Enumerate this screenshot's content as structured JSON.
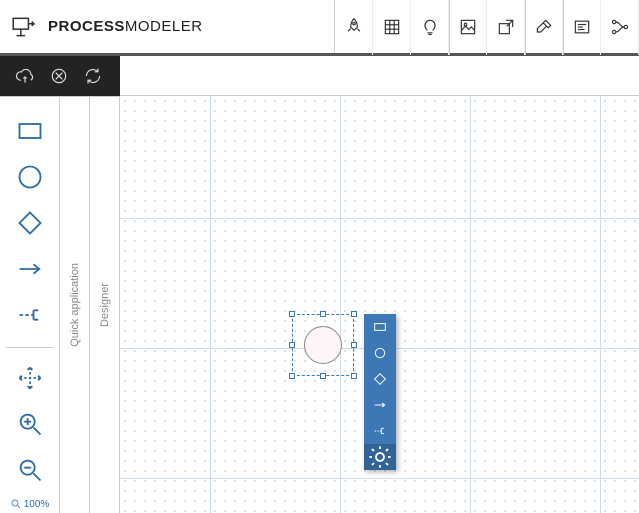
{
  "app": {
    "title_bold": "PROCESS",
    "title_rest": "MODELER"
  },
  "side_tabs": {
    "quick_app": "Quick application",
    "designer": "Designer"
  },
  "zoom": {
    "label": "100%"
  }
}
